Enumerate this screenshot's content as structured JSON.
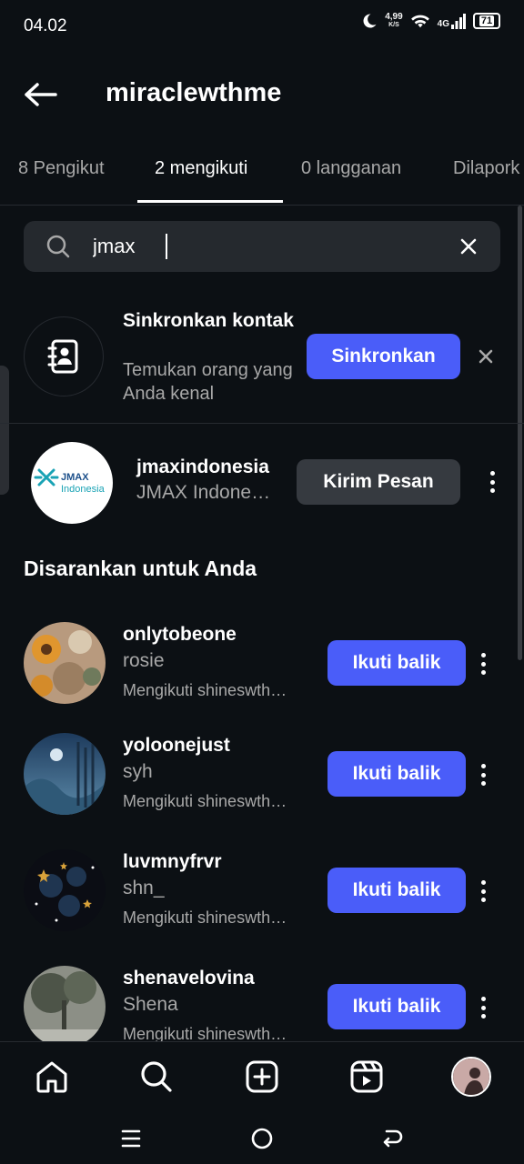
{
  "status_bar": {
    "time": "04.02",
    "net_speed_value": "4,99",
    "net_speed_unit": "K/S",
    "network": "4G",
    "battery": "71"
  },
  "header": {
    "title": "miraclewthme"
  },
  "tabs": [
    {
      "label": "8 Pengikut"
    },
    {
      "label": "2 mengikuti"
    },
    {
      "label": "0 langganan"
    },
    {
      "label": "Dilapork"
    }
  ],
  "search": {
    "value": "jmax"
  },
  "sync_contacts": {
    "title": "Sinkronkan kontak",
    "subtitle": "Temukan orang yang Anda kenal",
    "button_label": "Sinkronkan"
  },
  "result": {
    "username": "jmaxindonesia",
    "name": "JMAX Indone…",
    "button_label": "Kirim Pesan",
    "logo_line1": "JMAX",
    "logo_line2": "Indonesia"
  },
  "suggested": {
    "title": "Disarankan untuk Anda",
    "items": [
      {
        "username": "onlytobeone",
        "name": "rosie",
        "meta": "Mengikuti shineswth…",
        "button_label": "Ikuti balik"
      },
      {
        "username": "yoloonejust",
        "name": "syh",
        "meta": "Mengikuti shineswth…",
        "button_label": "Ikuti balik"
      },
      {
        "username": "luvmnyfrvr",
        "name": "shn_",
        "meta": "Mengikuti shineswth…",
        "button_label": "Ikuti balik"
      },
      {
        "username": "shenavelovina",
        "name": "Shena",
        "meta": "Mengikuti shineswth…",
        "button_label": "Ikuti balik"
      }
    ]
  },
  "colors": {
    "background": "#0c1014",
    "accent": "#4a5df9",
    "secondary_button": "#363a40",
    "muted_text": "#a8a8a8"
  }
}
